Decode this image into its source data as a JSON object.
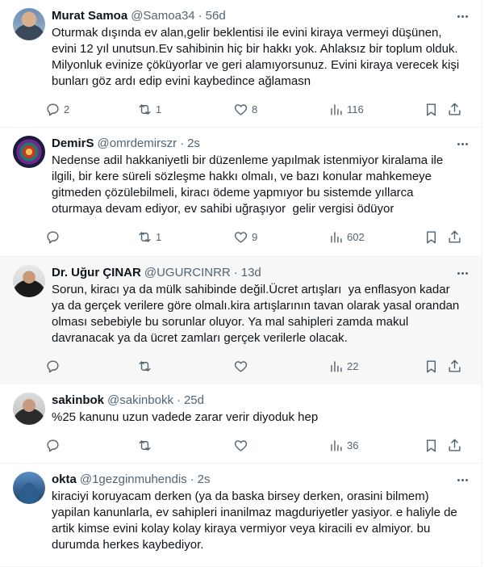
{
  "tweets": [
    {
      "name": "Murat Samoa",
      "handle": "@Samoa34",
      "time": "56d",
      "text": "Oturmak dışında ev alan,gelir beklentisi ile evini kiraya vermeyi düşünen,\nevini 12 yıl unutsun.Ev sahibinin hiç bir hakkı yok. Ahlaksız bir toplum olduk.\nMilyonluk evinize çöküyorlar ve geri alamıyorsunuz. Evini kiraya verecek kişi\nbunları göz ardı edip evini kaybedince ağlamasn",
      "replies": "2",
      "retweets": "1",
      "likes": "8",
      "views": "116"
    },
    {
      "name": "DemirS",
      "handle": "@omrdemirszr",
      "time": "2s",
      "text": "Nedense adil hakkaniyetli bir düzenleme yapılmak istenmiyor kiralama ile\nilgili, bir kere süreli sözleşme hakkı olmalı, ve bazı konular mahkemeye\ngitmeden çözülebilmeli, kiracı ödeme yapmıyor bu sistemde yıllarca\noturmaya devam ediyor, ev sahibi uğraşıyor  gelir vergisi ödüyor",
      "replies": "",
      "retweets": "1",
      "likes": "9",
      "views": "602"
    },
    {
      "name": "Dr. Uğur ÇINAR",
      "handle": "@UGURCINRR",
      "time": "13d",
      "text": "Sorun, kiracı ya da mülk sahibinde değil.Ücret artışları  ya enflasyon kadar\nya da gerçek verilere göre olmalı.kira artışlarının tavan olarak yasal orandan\nolması sebebiyle bu sorunlar oluyor. Ya mal sahipleri zamda makul\ndavranacak ya da ücret zamları gerçek verilerle olacak.",
      "replies": "",
      "retweets": "",
      "likes": "",
      "views": "22"
    },
    {
      "name": "sakinbok",
      "handle": "@sakinbokk",
      "time": "25d",
      "text": "%25 kanunu uzun vadede zarar verir diyoduk hep",
      "replies": "",
      "retweets": "",
      "likes": "",
      "views": "36"
    },
    {
      "name": "okta",
      "handle": "@1gezginmuhendis",
      "time": "2s",
      "text": "kiraciyi koruyacam derken (ya da baska birsey derken, orasini bilmem)\nyapilan kanunlarla, ev sahipleri inanilmaz magduriyetler yasiyor. e haliyle de\nartik kimse evini kolay kolay kiraya vermiyor veya kiracili ev almiyor. bu\ndurumda herkes kaybediyor."
    }
  ],
  "icons": {
    "reply": "reply-icon",
    "retweet": "retweet-icon",
    "like": "heart-icon",
    "views": "views-icon",
    "bookmark": "bookmark-icon",
    "share": "share-icon",
    "more": "more-icon"
  },
  "colors": {
    "text": "#0f1419",
    "secondary": "#536471",
    "divider": "#eff3f4",
    "highlight_bg": "#f7f7f7"
  }
}
